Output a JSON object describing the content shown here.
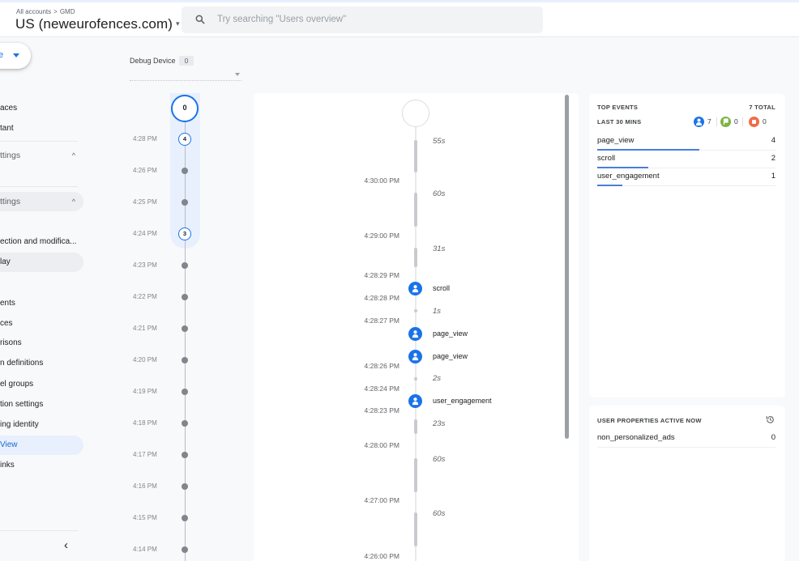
{
  "header": {
    "breadcrumb": [
      "All accounts",
      "GMD"
    ],
    "breadcrumb_separator": ">",
    "property_name": "US (neweurofences.com)",
    "property_caret": "▾",
    "search_placeholder": "Try searching \"Users overview\"",
    "search_icon": "search-icon"
  },
  "sidebar": {
    "create_button_label": "e",
    "items": [
      {
        "label": "aces",
        "type": "item"
      },
      {
        "label": "tant",
        "type": "item"
      },
      {
        "label": "ttings",
        "type": "section",
        "chevron": "^"
      },
      {
        "label": "ttings",
        "type": "section",
        "chevron": "^"
      },
      {
        "label": "ection and modifica...",
        "type": "item"
      },
      {
        "label": "lay",
        "type": "item",
        "state": "highlighted"
      },
      {
        "label": "ents",
        "type": "item"
      },
      {
        "label": "ces",
        "type": "item"
      },
      {
        "label": "risons",
        "type": "item"
      },
      {
        "label": "n definitions",
        "type": "item"
      },
      {
        "label": "el groups",
        "type": "item"
      },
      {
        "label": "tion settings",
        "type": "item"
      },
      {
        "label": "ing identity",
        "type": "item"
      },
      {
        "label": "View",
        "type": "item",
        "state": "active"
      },
      {
        "label": "inks",
        "type": "item"
      }
    ],
    "collapse_icon": "‹"
  },
  "debug_device": {
    "label": "Debug Device",
    "count": "0",
    "selected_value": ""
  },
  "minutes_stream": {
    "current_count": "0",
    "rows": [
      {
        "time": "4:28 PM",
        "count": "4"
      },
      {
        "time": "4:26 PM",
        "count": null
      },
      {
        "time": "4:25 PM",
        "count": null
      },
      {
        "time": "4:24 PM",
        "count": "3"
      },
      {
        "time": "4:23 PM",
        "count": null
      },
      {
        "time": "4:22 PM",
        "count": null
      },
      {
        "time": "4:21 PM",
        "count": null
      },
      {
        "time": "4:20 PM",
        "count": null
      },
      {
        "time": "4:19 PM",
        "count": null
      },
      {
        "time": "4:18 PM",
        "count": null
      },
      {
        "time": "4:17 PM",
        "count": null
      },
      {
        "time": "4:16 PM",
        "count": null
      },
      {
        "time": "4:15 PM",
        "count": null
      },
      {
        "time": "4:14 PM",
        "count": null
      }
    ]
  },
  "seconds_stream": {
    "timestamps": [
      "4:30:00 PM",
      "4:29:00 PM",
      "4:28:29 PM",
      "4:28:28 PM",
      "4:28:27 PM",
      "4:28:26 PM",
      "4:28:24 PM",
      "4:28:23 PM",
      "4:28:00 PM",
      "4:27:00 PM",
      "4:26:00 PM"
    ],
    "gaps": [
      "55s",
      "60s",
      "31s",
      "1s",
      "2s",
      "23s",
      "60s",
      "60s"
    ],
    "events": [
      {
        "name": "scroll",
        "icon": "user-event-icon"
      },
      {
        "name": "page_view",
        "icon": "user-event-icon"
      },
      {
        "name": "page_view",
        "icon": "user-event-icon"
      },
      {
        "name": "user_engagement",
        "icon": "user-event-icon"
      }
    ]
  },
  "top_events": {
    "title": "TOP EVENTS",
    "total_label": "7 TOTAL",
    "period_label": "LAST 30 MINS",
    "stats": [
      {
        "icon": "user-event-icon",
        "color": "#1a73e8",
        "value": "7"
      },
      {
        "icon": "conversion-flag-icon",
        "color": "#7cb342",
        "value": "0"
      },
      {
        "icon": "error-icon",
        "color": "#f06c47",
        "value": "0"
      }
    ],
    "rows": [
      {
        "name": "page_view",
        "count": "4",
        "share": 0.571
      },
      {
        "name": "scroll",
        "count": "2",
        "share": 0.286
      },
      {
        "name": "user_engagement",
        "count": "1",
        "share": 0.143
      }
    ],
    "bar_color": "#4a7ddb"
  },
  "user_properties": {
    "title": "USER PROPERTIES ACTIVE NOW",
    "history_icon": "history-icon",
    "rows": [
      {
        "name": "non_personalized_ads",
        "value": "0"
      }
    ]
  }
}
